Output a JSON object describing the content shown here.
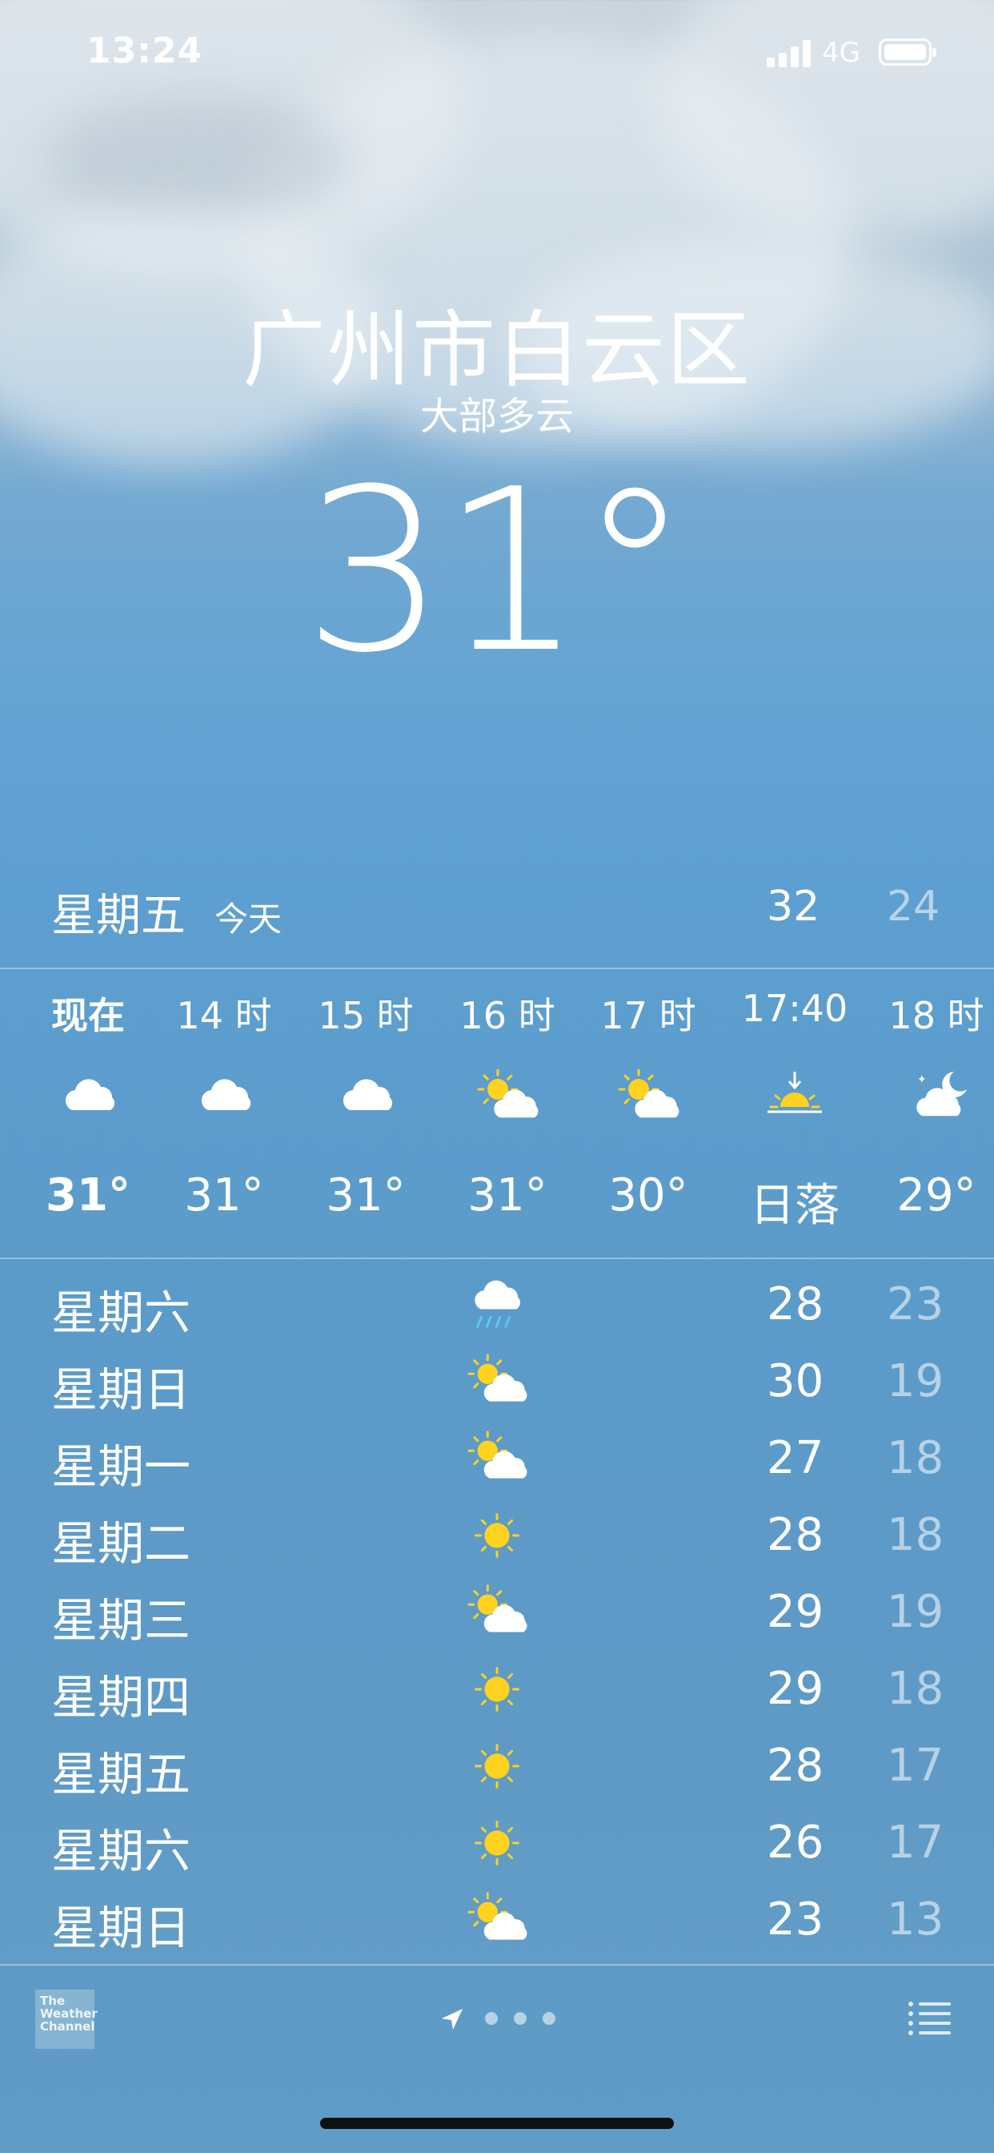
{
  "status_bar": {
    "time": "13:24",
    "network": "4G"
  },
  "location": {
    "city": "广州市白云区",
    "condition": "大部多云",
    "temperature": "31",
    "degree_symbol": "°"
  },
  "today": {
    "day": "星期五",
    "label": "今天",
    "high": "32",
    "low": "24"
  },
  "hourly": [
    {
      "label": "现在",
      "icon": "cloud-icon",
      "temp": "31°"
    },
    {
      "label": "14 时",
      "icon": "cloud-icon",
      "temp": "31°"
    },
    {
      "label": "15 时",
      "icon": "cloud-icon",
      "temp": "31°"
    },
    {
      "label": "16 时",
      "icon": "partly-sunny-icon",
      "temp": "31°"
    },
    {
      "label": "17 时",
      "icon": "partly-sunny-icon",
      "temp": "30°"
    },
    {
      "label": "17:40",
      "icon": "sunset-icon",
      "temp": "日落"
    },
    {
      "label": "18 时",
      "icon": "partly-cloudy-night-icon",
      "temp": "29°"
    }
  ],
  "daily": [
    {
      "day": "星期六",
      "icon": "rain-icon",
      "high": "28",
      "low": "23"
    },
    {
      "day": "星期日",
      "icon": "partly-sunny-icon",
      "high": "30",
      "low": "19"
    },
    {
      "day": "星期一",
      "icon": "partly-sunny-icon",
      "high": "27",
      "low": "18"
    },
    {
      "day": "星期二",
      "icon": "sun-icon",
      "high": "28",
      "low": "18"
    },
    {
      "day": "星期三",
      "icon": "partly-sunny-icon",
      "high": "29",
      "low": "19"
    },
    {
      "day": "星期四",
      "icon": "sun-icon",
      "high": "29",
      "low": "18"
    },
    {
      "day": "星期五",
      "icon": "sun-icon",
      "high": "28",
      "low": "17"
    },
    {
      "day": "星期六",
      "icon": "sun-icon",
      "high": "26",
      "low": "17"
    },
    {
      "day": "星期日",
      "icon": "partly-sunny-icon",
      "high": "23",
      "low": "13"
    }
  ],
  "bottom_bar": {
    "logo_text": "The Weather Channel",
    "page_count": 3,
    "icons": [
      "location-arrow-icon",
      "list-icon"
    ]
  },
  "colors": {
    "sun": "#FFD21F",
    "cloud": "#FFFFFF",
    "rain": "#5AC8FA",
    "low_temp": "rgba(255,255,255,0.55)"
  }
}
